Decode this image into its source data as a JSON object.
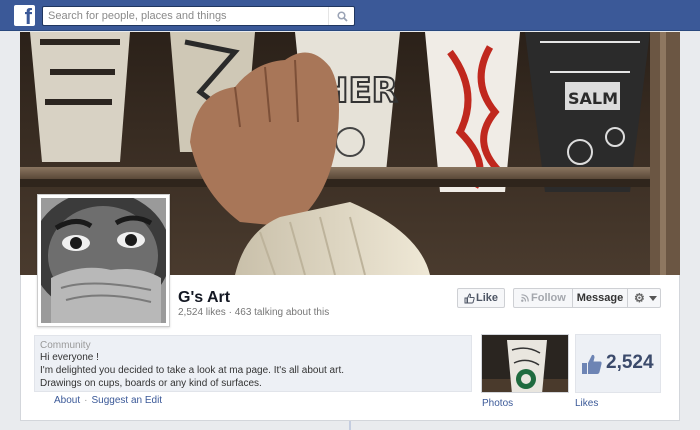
{
  "topbar": {
    "logo": "f",
    "search_placeholder": "Search for people, places and things",
    "search_icon": "magnifier-icon"
  },
  "page": {
    "name": "G's Art",
    "stats": "2,524 likes · 463 talking about this",
    "cover_description_icon": "cover-photo",
    "profile_icon": "profile-photo"
  },
  "actions": {
    "like_label": "Like",
    "follow_label": "Follow",
    "message_label": "Message",
    "gear_icon": "gear-icon"
  },
  "about": {
    "category": "Community",
    "line1": "Hi everyone !",
    "line2": "I'm delighted you decided to take a look at ma page. It's all about art.",
    "line3": "Drawings on cups, boards or any kind of surfaces.",
    "about_link": "About",
    "separator": "·",
    "suggest_link": "Suggest an Edit"
  },
  "photos": {
    "label": "Photos"
  },
  "likes": {
    "count": "2,524",
    "label": "Likes"
  },
  "colors": {
    "brand": "#3b5998",
    "link": "#3b5998",
    "panel": "#edf0f5"
  }
}
